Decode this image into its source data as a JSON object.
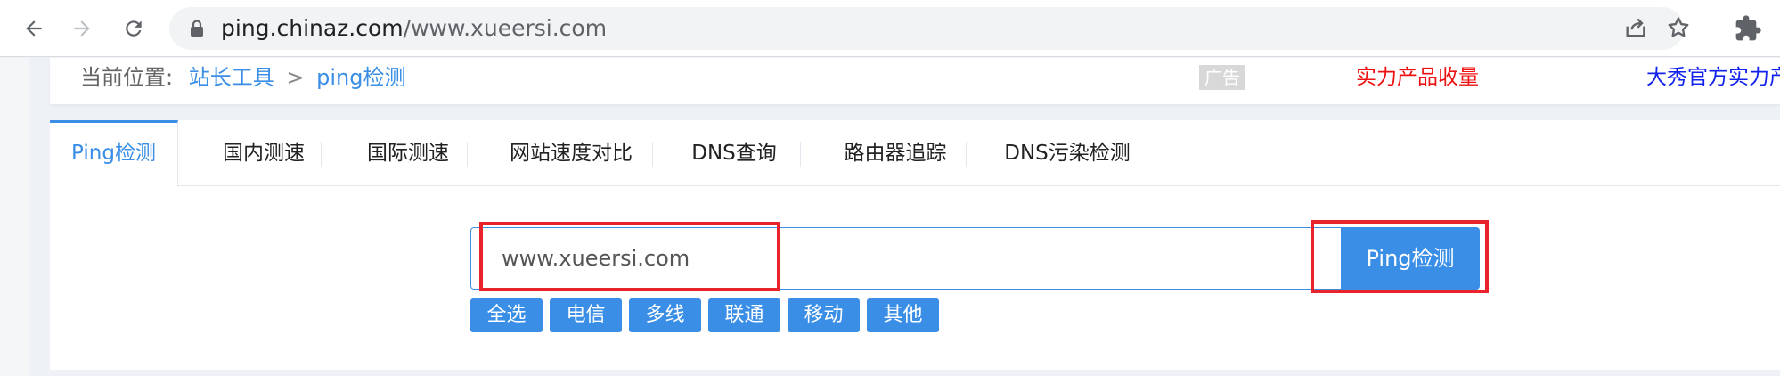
{
  "browser": {
    "url_host": "ping.chinaz.com",
    "url_path": "/www.xueersi.com",
    "icons": [
      "back-icon",
      "forward-icon",
      "reload-icon",
      "lock-icon",
      "share-icon",
      "star-icon",
      "extensions-icon"
    ]
  },
  "breadcrumb": {
    "prefix": "当前位置:",
    "root": "站长工具",
    "separator": ">",
    "current": "ping检测"
  },
  "ads": {
    "badge": "广告",
    "red_text": "实力产品收量",
    "blue_text": "大秀官方实力产品无"
  },
  "tabs": [
    {
      "label": "Ping检测",
      "active": true
    },
    {
      "label": "国内测速",
      "active": false
    },
    {
      "label": "国际测速",
      "active": false
    },
    {
      "label": "网站速度对比",
      "active": false
    },
    {
      "label": "DNS查询",
      "active": false
    },
    {
      "label": "路由器追踪",
      "active": false
    },
    {
      "label": "DNS污染检测",
      "active": false
    }
  ],
  "search": {
    "value": "www.xueersi.com",
    "button_label": "Ping检测"
  },
  "filters": [
    "全选",
    "电信",
    "多线",
    "联通",
    "移动",
    "其他"
  ],
  "colors": {
    "accent": "#3a8ee6",
    "highlight": "#e8232b",
    "ad_red": "#ee1111",
    "ad_blue": "#1122ee"
  }
}
